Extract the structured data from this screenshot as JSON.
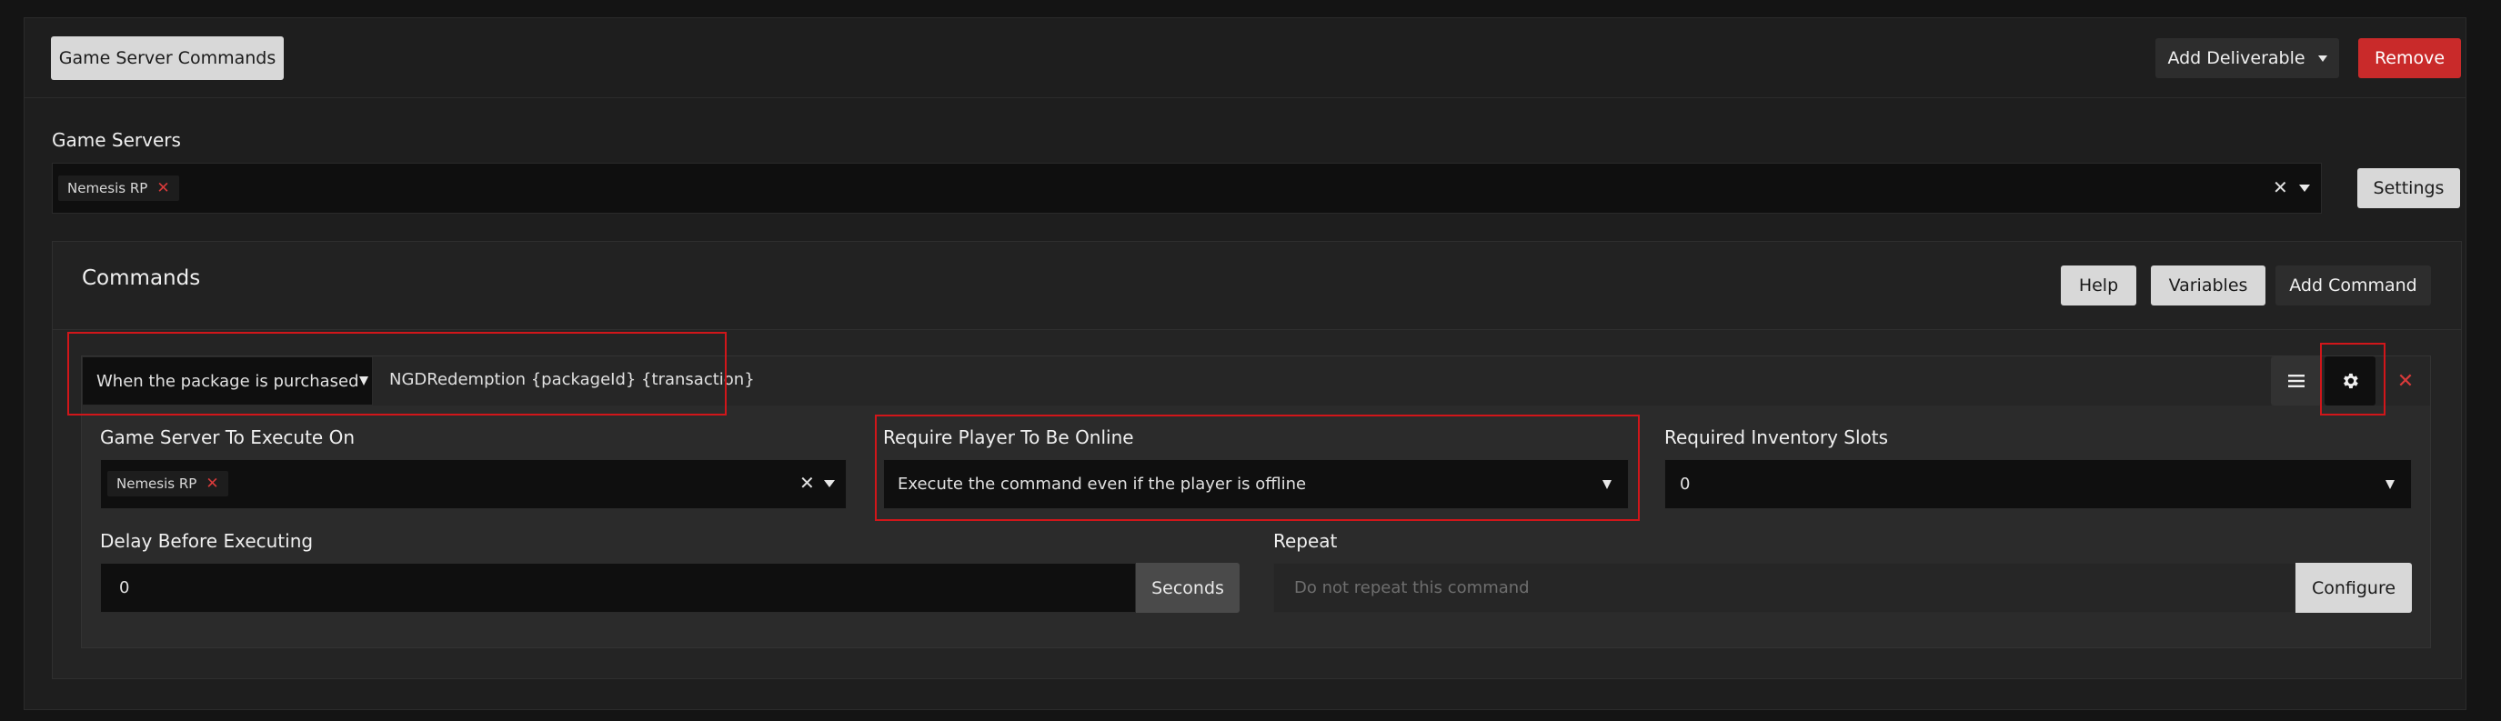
{
  "header": {
    "deliverable_type": "Game Server Commands",
    "add_deliverable_label": "Add Deliverable",
    "remove_label": "Remove"
  },
  "game_servers": {
    "label": "Game Servers",
    "tags": [
      "Nemesis RP"
    ],
    "settings_label": "Settings"
  },
  "commands": {
    "title": "Commands",
    "help_label": "Help",
    "variables_label": "Variables",
    "add_command_label": "Add Command",
    "command": {
      "trigger": "When the package is purchased",
      "text": "NGDRedemption {packageId} {transaction}",
      "options": {
        "server_label": "Game Server To Execute On",
        "server_tags": [
          "Nemesis RP"
        ],
        "online_label": "Require Player To Be Online",
        "online_value": "Execute the command even if the player is offline",
        "slots_label": "Required Inventory Slots",
        "slots_value": "0",
        "delay_label": "Delay Before Executing",
        "delay_value": "0",
        "delay_unit": "Seconds",
        "repeat_label": "Repeat",
        "repeat_placeholder": "Do not repeat this command",
        "configure_label": "Configure"
      }
    }
  },
  "colors": {
    "background": "#141414",
    "panel": "#1e1e1e",
    "accent_red": "#c92a2a",
    "highlight_red": "#d1161a"
  },
  "icons": {
    "reorder": "hamburger-icon",
    "settings": "gear-icon",
    "delete": "close-icon"
  }
}
